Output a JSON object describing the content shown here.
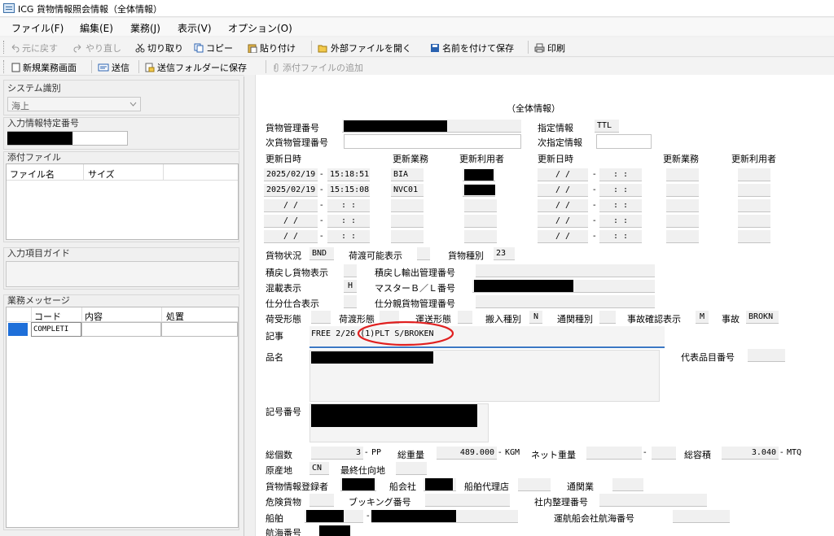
{
  "window": {
    "title": "ICG 貨物情報照会情報（全体情報）"
  },
  "menu": [
    "ファイル(F)",
    "編集(E)",
    "業務(J)",
    "表示(V)",
    "オプション(O)"
  ],
  "toolbar1": {
    "undo": "元に戻す",
    "redo": "やり直し",
    "cut": "切り取り",
    "copy": "コピー",
    "paste": "貼り付け",
    "open_external": "外部ファイルを開く",
    "save_as": "名前を付けて保存",
    "print": "印刷"
  },
  "toolbar2": {
    "new_screen": "新規業務画面",
    "send": "送信",
    "save_to_send_folder": "送信フォルダーに保存",
    "add_attachment": "添付ファイルの追加"
  },
  "left": {
    "system_label": "システム識別",
    "system_value": "海上",
    "input_id_label": "入力情報特定番号",
    "attach_label": "添付ファイル",
    "attach_cols": [
      "ファイル名",
      "サイズ"
    ],
    "guide_label": "入力項目ガイド",
    "msg_label": "業務メッセージ",
    "msg_cols": [
      "コード",
      "内容",
      "処置"
    ],
    "msg_row_code": "COMPLETI"
  },
  "form": {
    "heading": "（全体情報）",
    "cargo_no_label": "貨物管理番号",
    "designation_label": "指定情報",
    "designation_value": "TTL",
    "next_cargo_label": "次貨物管理番号",
    "next_designation_label": "次指定情報",
    "update_dt_label": "更新日時",
    "update_job_label": "更新業務",
    "update_user_label": "更新利用者",
    "rows": [
      {
        "date": "2025/02/19",
        "time": "15:18:51",
        "job": "BIA"
      },
      {
        "date": "2025/02/19",
        "time": "15:15:08",
        "job": "NVC01"
      },
      {
        "date": "/ /",
        "time": ": :",
        "job": ""
      },
      {
        "date": "/ /",
        "time": ": :",
        "job": ""
      },
      {
        "date": "/ /",
        "time": ": :",
        "job": ""
      }
    ],
    "empty_date": "/ /",
    "empty_time": ": :",
    "dash": "-",
    "status_label": "貨物状況",
    "status_value": "BND",
    "transport_label": "荷渡可能表示",
    "cargo_type_label": "貨物種別",
    "cargo_type_value": "23",
    "reexport_label": "積戻し貨物表示",
    "reexport_no_label": "積戻し輸出管理番号",
    "mixed_label": "混載表示",
    "mixed_value": "H",
    "master_bl_label": "マスターＢ／Ｌ番号",
    "shiwake_label": "仕分仕合表示",
    "shiwake_mgmt_label": "仕分親貨物管理番号",
    "receive_label": "荷受形態",
    "deliver_label": "荷渡形態",
    "carry_label": "運送形態",
    "import_type_label": "搬入種別",
    "import_type_value": "N",
    "customs_type_label": "通関種別",
    "accident_label": "事故確認表示",
    "accident_value": "M",
    "accident2_label": "事故",
    "accident2_value": "BROKN",
    "note_label": "記事",
    "note_value": "FREE 2/26 (1)PLT S/BROKEN",
    "item_label": "品名",
    "rep_item_label": "代表品目番号",
    "marks_label": "記号番号",
    "pkg_label": "総個数",
    "pkg_value": "3",
    "pkg_unit": "PP",
    "weight_label": "総重量",
    "weight_value": "489.000",
    "weight_unit": "KGM",
    "net_label": "ネット重量",
    "vol_label": "総容積",
    "vol_value": "3.040",
    "vol_unit": "MTQ",
    "origin_label": "原産地",
    "origin_value": "CN",
    "final_dest_label": "最終仕向地",
    "registrant_label": "貨物情報登録者",
    "shipco_label": "船会社",
    "agent_label": "船舶代理店",
    "broker_label": "通関業",
    "danger_label": "危険貨物",
    "booking_label": "ブッキング番号",
    "internal_label": "社内整理番号",
    "vessel_label": "船舶",
    "voyage_op_label": "運航船会社航海番号",
    "voyage_label": "航海番号"
  },
  "colors": {
    "annotation": "#e02020",
    "selection": "#1e6fd9",
    "redaction": "#000000"
  }
}
